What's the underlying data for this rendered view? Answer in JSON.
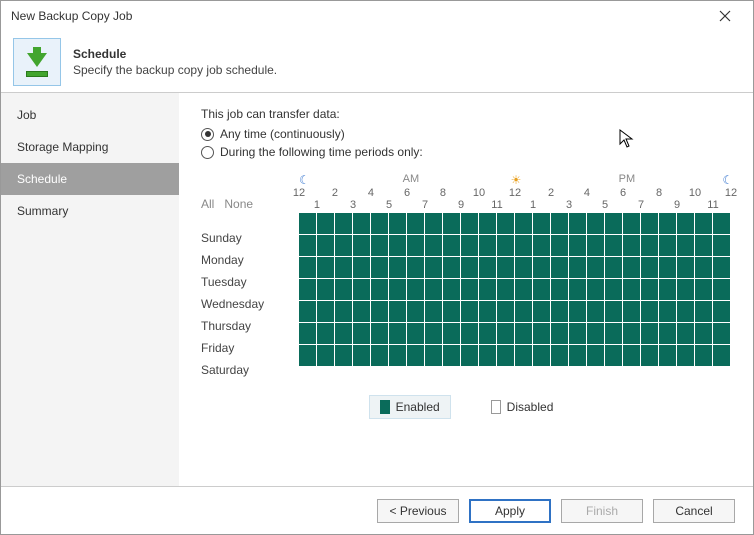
{
  "window": {
    "title": "New Backup Copy Job"
  },
  "header": {
    "title": "Schedule",
    "subtitle": "Specify the backup copy job schedule."
  },
  "sidebar": {
    "items": [
      {
        "label": "Job"
      },
      {
        "label": "Storage Mapping"
      },
      {
        "label": "Schedule"
      },
      {
        "label": "Summary"
      }
    ],
    "selected_index": 2
  },
  "main": {
    "section_label": "This job can transfer data:",
    "radios": [
      {
        "label": "Any time (continuously)",
        "checked": true
      },
      {
        "label": "During the following time periods only:",
        "checked": false
      }
    ],
    "allnone": {
      "all": "All",
      "none": "None"
    },
    "days": [
      "Sunday",
      "Monday",
      "Tuesday",
      "Wednesday",
      "Thursday",
      "Friday",
      "Saturday"
    ],
    "ampm": {
      "am": "AM",
      "pm": "PM"
    },
    "hours_top": [
      "12",
      "2",
      "4",
      "6",
      "8",
      "10",
      "12",
      "2",
      "4",
      "6",
      "8",
      "10",
      "12"
    ],
    "hours_bot": [
      "1",
      "3",
      "5",
      "7",
      "9",
      "11",
      "1",
      "3",
      "5",
      "7",
      "9",
      "11"
    ],
    "legend": {
      "enabled": "Enabled",
      "disabled": "Disabled"
    }
  },
  "chart_data": {
    "type": "heatmap",
    "title": "Backup copy job schedule",
    "rows": [
      "Sunday",
      "Monday",
      "Tuesday",
      "Wednesday",
      "Thursday",
      "Friday",
      "Saturday"
    ],
    "columns_hours_24": [
      0,
      1,
      2,
      3,
      4,
      5,
      6,
      7,
      8,
      9,
      10,
      11,
      12,
      13,
      14,
      15,
      16,
      17,
      18,
      19,
      20,
      21,
      22,
      23
    ],
    "values_note": "1 = Enabled, 0 = Disabled",
    "values": [
      [
        1,
        1,
        1,
        1,
        1,
        1,
        1,
        1,
        1,
        1,
        1,
        1,
        1,
        1,
        1,
        1,
        1,
        1,
        1,
        1,
        1,
        1,
        1,
        1
      ],
      [
        1,
        1,
        1,
        1,
        1,
        1,
        1,
        1,
        1,
        1,
        1,
        1,
        1,
        1,
        1,
        1,
        1,
        1,
        1,
        1,
        1,
        1,
        1,
        1
      ],
      [
        1,
        1,
        1,
        1,
        1,
        1,
        1,
        1,
        1,
        1,
        1,
        1,
        1,
        1,
        1,
        1,
        1,
        1,
        1,
        1,
        1,
        1,
        1,
        1
      ],
      [
        1,
        1,
        1,
        1,
        1,
        1,
        1,
        1,
        1,
        1,
        1,
        1,
        1,
        1,
        1,
        1,
        1,
        1,
        1,
        1,
        1,
        1,
        1,
        1
      ],
      [
        1,
        1,
        1,
        1,
        1,
        1,
        1,
        1,
        1,
        1,
        1,
        1,
        1,
        1,
        1,
        1,
        1,
        1,
        1,
        1,
        1,
        1,
        1,
        1
      ],
      [
        1,
        1,
        1,
        1,
        1,
        1,
        1,
        1,
        1,
        1,
        1,
        1,
        1,
        1,
        1,
        1,
        1,
        1,
        1,
        1,
        1,
        1,
        1,
        1
      ],
      [
        1,
        1,
        1,
        1,
        1,
        1,
        1,
        1,
        1,
        1,
        1,
        1,
        1,
        1,
        1,
        1,
        1,
        1,
        1,
        1,
        1,
        1,
        1,
        1
      ]
    ]
  },
  "footer": {
    "previous": "< Previous",
    "apply": "Apply",
    "finish": "Finish",
    "cancel": "Cancel"
  }
}
